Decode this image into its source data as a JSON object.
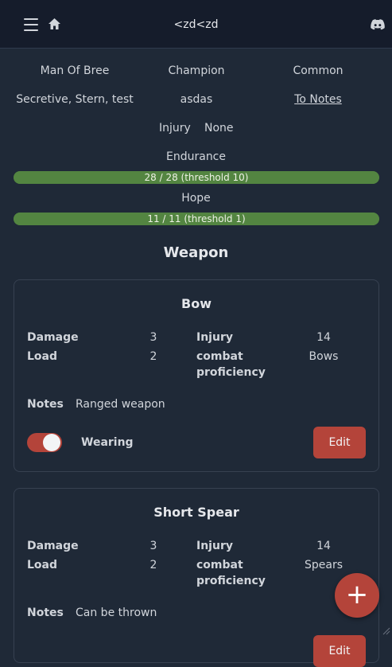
{
  "topbar": {
    "title": "<zd<zd",
    "menu_icon": "hamburger-icon",
    "home_icon": "home-icon",
    "discord_icon": "discord-icon"
  },
  "character": {
    "culture": "Man Of Bree",
    "calling": "Champion",
    "standard": "Common",
    "traits": "Secretive, Stern, test",
    "patron": "asdas",
    "notes_link": "To Notes",
    "injury_label": "Injury",
    "injury_value": "None"
  },
  "endurance": {
    "label": "Endurance",
    "text": "28 / 28 (threshold 10)",
    "current": 28,
    "max": 28
  },
  "hope": {
    "label": "Hope",
    "text": "11 / 11 (threshold 1)",
    "current": 11,
    "max": 11
  },
  "section_title": "Weapon",
  "weapons": [
    {
      "name": "Bow",
      "damage_label": "Damage",
      "damage": "3",
      "load_label": "Load",
      "load": "2",
      "injury_label": "Injury",
      "injury": "14",
      "prof_label_1": "combat",
      "prof_label_2": "proficiency",
      "proficiency": "Bows",
      "notes_label": "Notes",
      "notes": "Ranged weapon",
      "wearing_label": "Wearing",
      "wearing": true,
      "edit_label": "Edit"
    },
    {
      "name": "Short Spear",
      "damage_label": "Damage",
      "damage": "3",
      "load_label": "Load",
      "load": "2",
      "injury_label": "Injury",
      "injury": "14",
      "prof_label_1": "combat",
      "prof_label_2": "proficiency",
      "proficiency": "Spears",
      "notes_label": "Notes",
      "notes": "Can be thrown",
      "edit_label": "Edit"
    }
  ],
  "fab_label": "+",
  "colors": {
    "accent": "#b4443a",
    "bar": "#538541",
    "background": "#1f2937",
    "topbar": "#151c2b"
  }
}
